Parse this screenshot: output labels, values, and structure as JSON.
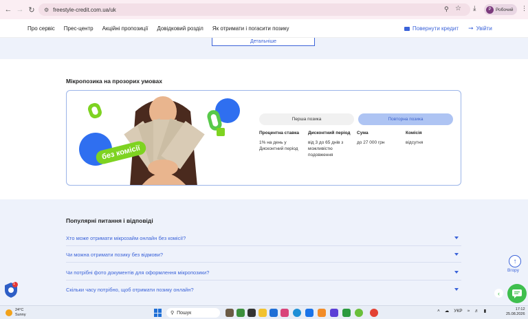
{
  "browser": {
    "url": "freestyle-credit.com.ua/uk",
    "profile_initial": "Р",
    "profile_name": "Робочий"
  },
  "header": {
    "menu": [
      "Про сервіс",
      "Прес-центр",
      "Акційні пропозиції",
      "Довідковий розділ",
      "Як отримати і погасити позику"
    ],
    "return_credit": "Повернути кредит",
    "login": "Увійти"
  },
  "details_button": "Детальніше",
  "loan": {
    "title": "Мікропозика на прозорих умовах",
    "promo_text": "без комісії",
    "tab_first": "Перша позика",
    "tab_repeat": "Повторна позика",
    "columns": [
      {
        "head": "Процентна ставка",
        "value": "1% на день у Дисконтний період"
      },
      {
        "head": "Дисконтний період",
        "value": "від 3 до 65 днів з можливістю подовження"
      },
      {
        "head": "Сума",
        "value": "до 27 000 грн"
      },
      {
        "head": "Комісія",
        "value": "відсутня"
      }
    ]
  },
  "faq": {
    "title": "Популярні питання і відповіді",
    "items": [
      "Хто може отримати мікрозайм онлайн без комісії?",
      "Чи можна отримати позику без відмови?",
      "Чи потрібні фото документів для оформлення мікропозики?",
      "Скільки часу потрібно, щоб отримати позику онлайн?"
    ]
  },
  "floating": {
    "up_label": "Вгору",
    "notification_count": "1"
  },
  "taskbar": {
    "temperature": "24°C",
    "weather": "Sunny",
    "search": "Пошук",
    "language": "УКР",
    "time": "17:12",
    "date": "25.08.2026"
  },
  "colors": {
    "brand_blue": "#3b63d9",
    "brand_green": "#3fbf4e",
    "accent_lime": "#7ed321"
  }
}
